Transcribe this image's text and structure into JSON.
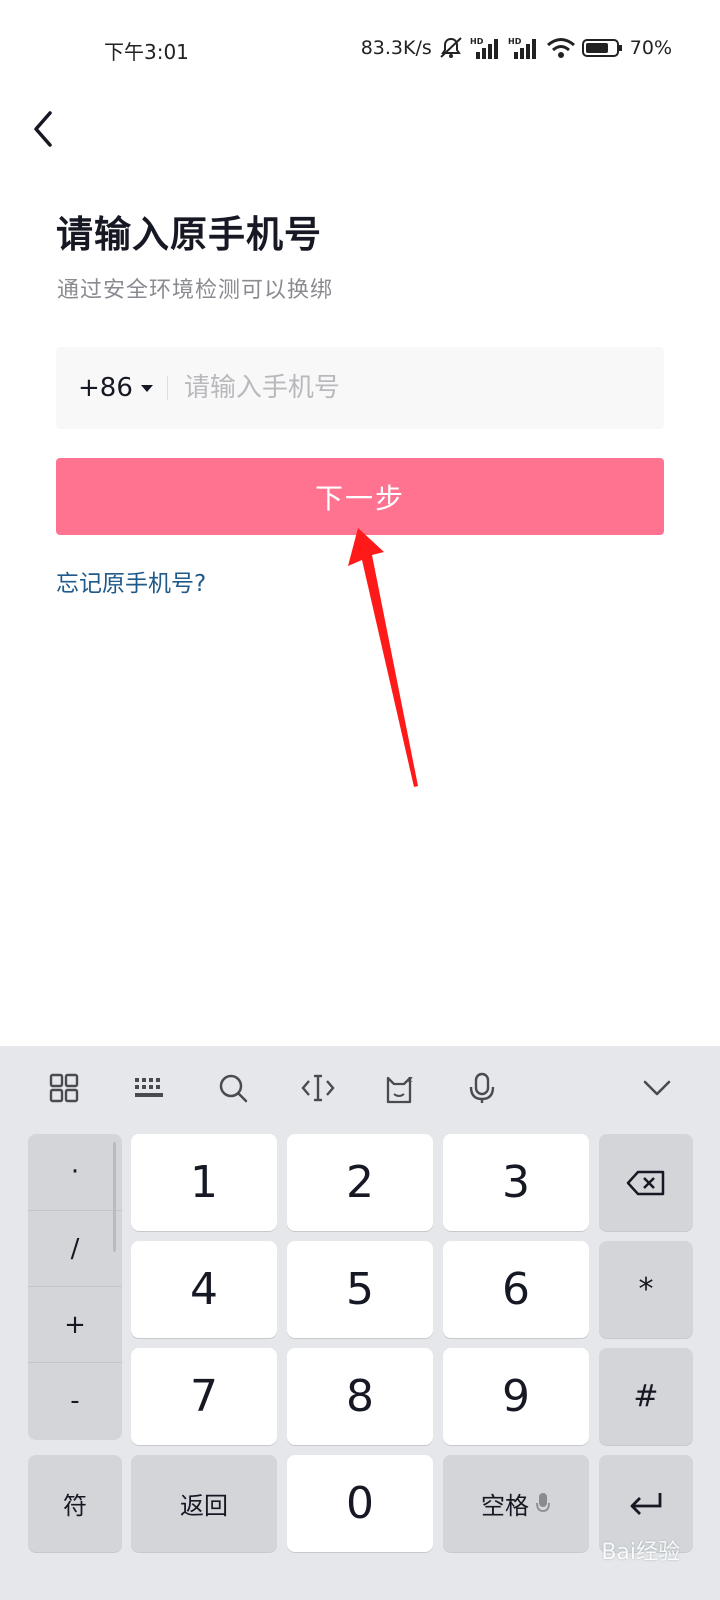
{
  "status_bar": {
    "time": "下午3:01",
    "net_speed": "83.3K/s",
    "battery": "70%"
  },
  "nav": {
    "back_icon": "chevron-left-icon"
  },
  "page": {
    "title": "请输入原手机号",
    "subtitle": "通过安全环境检测可以换绑",
    "country_code": "+86",
    "phone_placeholder": "请输入手机号",
    "next_label": "下一步",
    "forgot_label": "忘记原手机号?"
  },
  "keyboard": {
    "toolbar_icons": [
      "grid-icon",
      "keyboard-icon",
      "search-icon",
      "cursor-icon",
      "emoji-cat-icon",
      "microphone-icon",
      "collapse-icon"
    ],
    "symbols": [
      "·",
      "/",
      "+",
      "-"
    ],
    "digits": [
      "1",
      "2",
      "3",
      "4",
      "5",
      "6",
      "7",
      "8",
      "9",
      "0"
    ],
    "star": "*",
    "hash": "#",
    "fu_label": "符",
    "back_label": "返回",
    "space_label": "空格"
  },
  "watermark": "Bai经验",
  "colors": {
    "accent": "#ff7290",
    "link": "#1f5a8a",
    "arrow": "#ff1a1a"
  }
}
